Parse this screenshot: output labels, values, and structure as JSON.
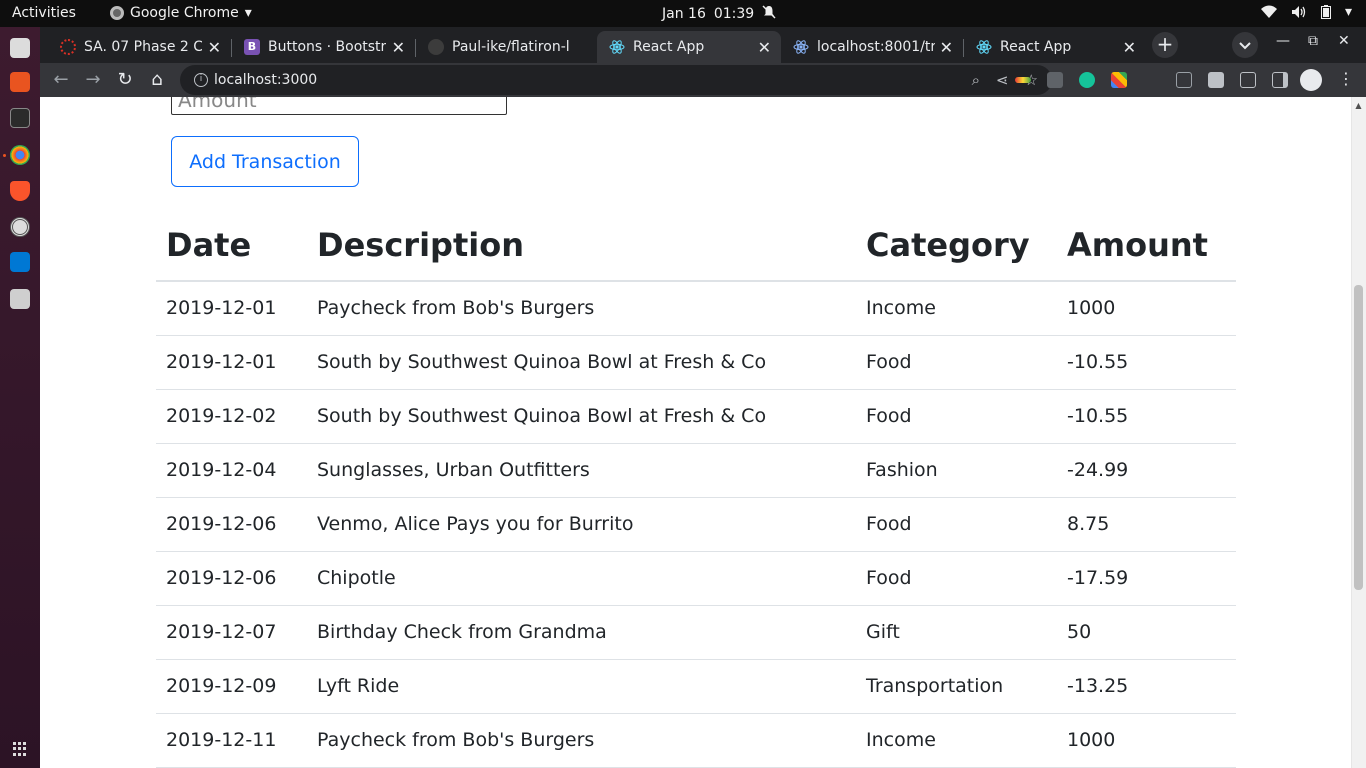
{
  "system_bar": {
    "activities": "Activities",
    "app_name": "Google Chrome",
    "date": "Jan 16",
    "time": "01:39"
  },
  "browser": {
    "tabs": [
      {
        "label": "SA. 07 Phase 2 Co",
        "icon": "circle-icon",
        "color": "#d93025"
      },
      {
        "label": "Buttons · Bootstr",
        "icon": "bootstrap-icon",
        "color": "#7952b3"
      },
      {
        "label": "Paul-ike/flatiron-l",
        "icon": "github-icon",
        "color": "#555555"
      },
      {
        "label": "React App",
        "icon": "react-icon",
        "color": "#61dafb",
        "active": true
      },
      {
        "label": "localhost:8001/tr",
        "icon": "globe-icon",
        "color": "#8ab4f8"
      },
      {
        "label": "React App",
        "icon": "react-icon",
        "color": "#61dafb"
      }
    ],
    "url": "localhost:3000"
  },
  "form": {
    "amount_placeholder": "Amount",
    "add_button": "Add Transaction"
  },
  "table": {
    "headers": [
      "Date",
      "Description",
      "Category",
      "Amount"
    ],
    "rows": [
      {
        "date": "2019-12-01",
        "description": "Paycheck from Bob's Burgers",
        "category": "Income",
        "amount": "1000"
      },
      {
        "date": "2019-12-01",
        "description": "South by Southwest Quinoa Bowl at Fresh & Co",
        "category": "Food",
        "amount": "-10.55"
      },
      {
        "date": "2019-12-02",
        "description": "South by Southwest Quinoa Bowl at Fresh & Co",
        "category": "Food",
        "amount": "-10.55"
      },
      {
        "date": "2019-12-04",
        "description": "Sunglasses, Urban Outfitters",
        "category": "Fashion",
        "amount": "-24.99"
      },
      {
        "date": "2019-12-06",
        "description": "Venmo, Alice Pays you for Burrito",
        "category": "Food",
        "amount": "8.75"
      },
      {
        "date": "2019-12-06",
        "description": "Chipotle",
        "category": "Food",
        "amount": "-17.59"
      },
      {
        "date": "2019-12-07",
        "description": "Birthday Check from Grandma",
        "category": "Gift",
        "amount": "50"
      },
      {
        "date": "2019-12-09",
        "description": "Lyft Ride",
        "category": "Transportation",
        "amount": "-13.25"
      },
      {
        "date": "2019-12-11",
        "description": "Paycheck from Bob's Burgers",
        "category": "Income",
        "amount": "1000"
      }
    ]
  },
  "colors": {
    "accent": "#0d6efd",
    "text": "#212529",
    "border": "#dee2e6"
  }
}
